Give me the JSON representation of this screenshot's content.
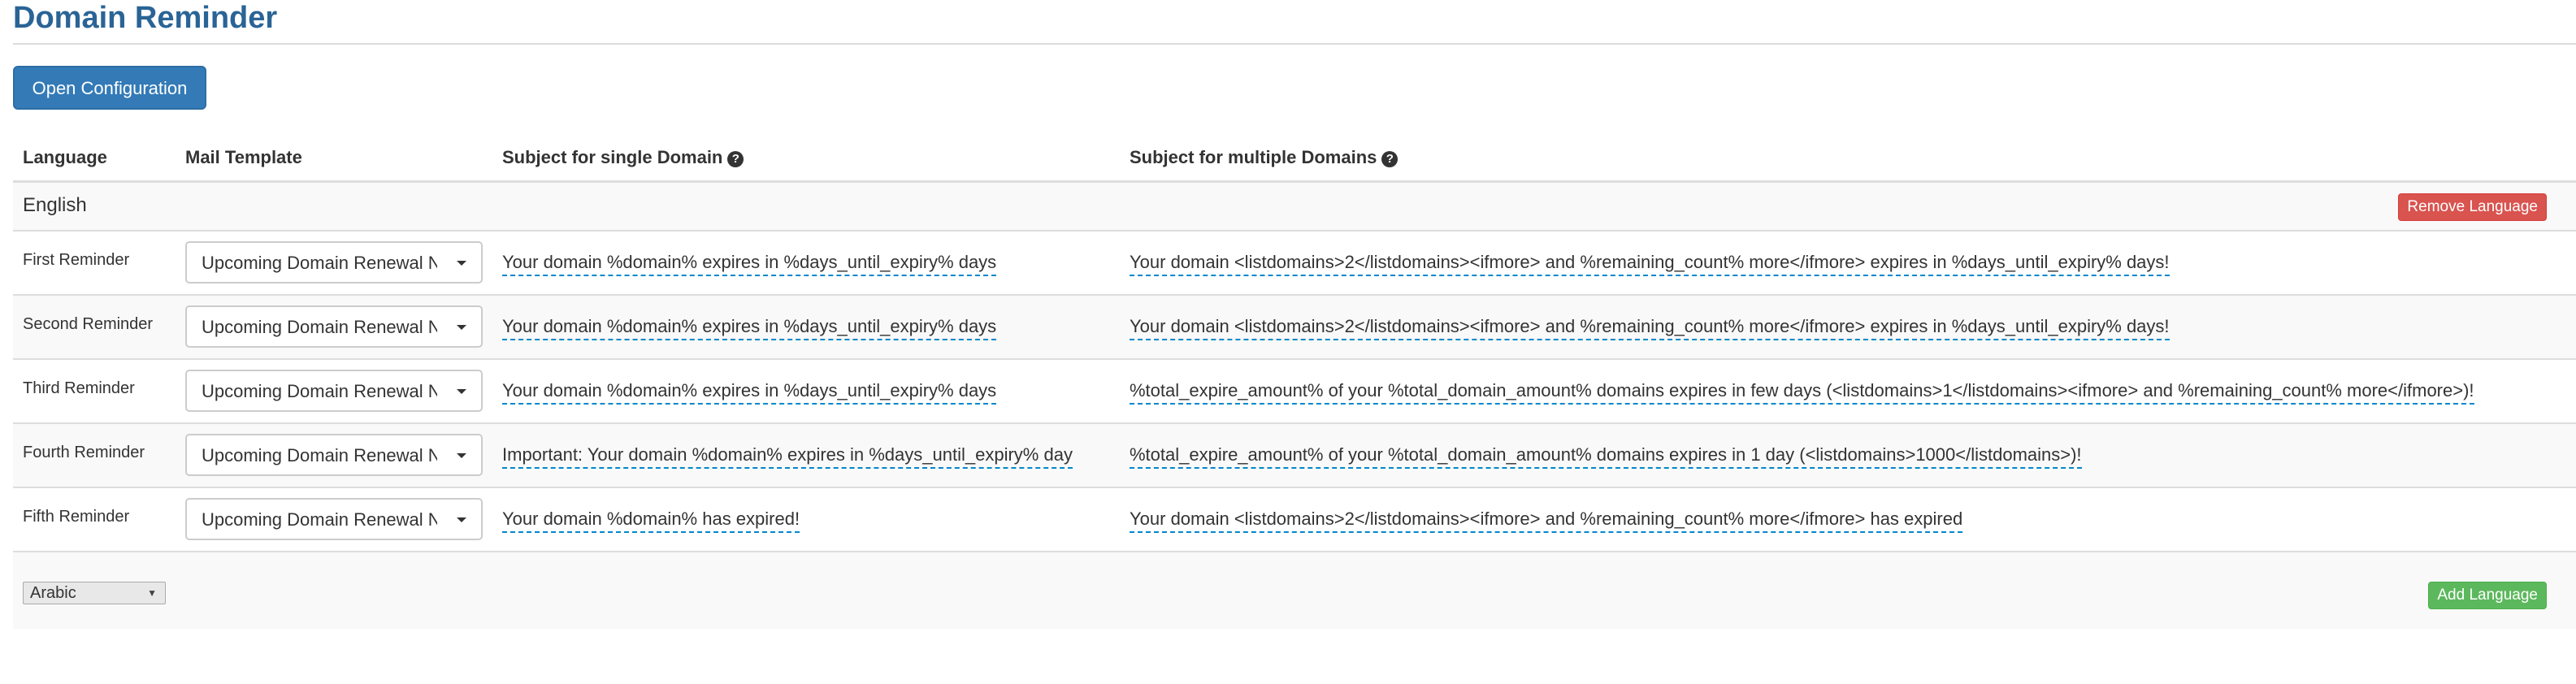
{
  "page": {
    "title": "Domain Reminder",
    "open_config_label": "Open Configuration"
  },
  "table": {
    "headers": {
      "language": "Language",
      "mail_template": "Mail Template",
      "subject_single": "Subject for single Domain",
      "subject_multiple": "Subject for multiple Domains"
    },
    "help_icon_glyph": "?",
    "language_block": {
      "name": "English",
      "remove_label": "Remove Language"
    },
    "rows": [
      {
        "label": "First Reminder",
        "template": "Upcoming Domain Renewal Notice",
        "subject_single": "Your domain %domain% expires in %days_until_expiry% days",
        "subject_multiple": "Your domain <listdomains>2</listdomains><ifmore> and %remaining_count% more</ifmore> expires in %days_until_expiry% days!"
      },
      {
        "label": "Second Reminder",
        "template": "Upcoming Domain Renewal Notice",
        "subject_single": "Your domain %domain% expires in %days_until_expiry% days",
        "subject_multiple": "Your domain <listdomains>2</listdomains><ifmore> and %remaining_count% more</ifmore> expires in %days_until_expiry% days!"
      },
      {
        "label": "Third Reminder",
        "template": "Upcoming Domain Renewal Notice",
        "subject_single": "Your domain %domain% expires in %days_until_expiry% days",
        "subject_multiple": "%total_expire_amount% of your %total_domain_amount% domains expires in few days (<listdomains>1</listdomains><ifmore> and %remaining_count% more</ifmore>)!"
      },
      {
        "label": "Fourth Reminder",
        "template": "Upcoming Domain Renewal Notice",
        "subject_single": "Important: Your domain %domain% expires in %days_until_expiry% day",
        "subject_multiple": "%total_expire_amount% of your %total_domain_amount% domains expires in 1 day (<listdomains>1000</listdomains>)!"
      },
      {
        "label": "Fifth Reminder",
        "template": "Upcoming Domain Renewal Notice",
        "subject_single": "Your domain %domain% has expired!",
        "subject_multiple": "Your domain <listdomains>2</listdomains><ifmore> and %remaining_count% more</ifmore> has expired"
      }
    ],
    "add_language": {
      "selected": "Arabic",
      "add_label": "Add Language"
    }
  },
  "colors": {
    "title": "#2a6496",
    "primary": "#337ab7",
    "danger": "#d9534f",
    "success": "#5cb85c",
    "editable_underline": "#0088cc"
  },
  "icons": {
    "help": "question-circle-icon",
    "dropdown": "caret-down-icon"
  }
}
